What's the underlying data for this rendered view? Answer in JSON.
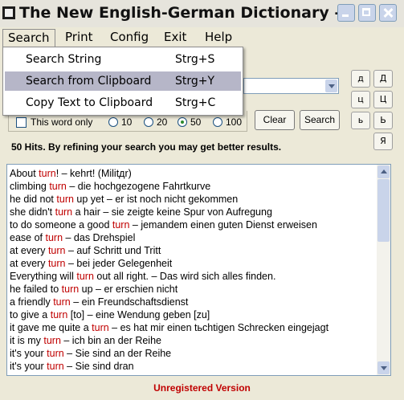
{
  "window": {
    "title": "The New English-German Dictionary - -"
  },
  "menu": [
    "Search",
    "Print",
    "Config",
    "Exit",
    "Help"
  ],
  "search_menu": {
    "items": [
      {
        "label": "Search String",
        "shortcut": "Strg+S"
      },
      {
        "label": "Search from Clipboard",
        "shortcut": "Strg+Y"
      },
      {
        "label": "Copy Text to Clipboard",
        "shortcut": "Strg+C"
      }
    ]
  },
  "search_combo": {
    "value": ""
  },
  "char_buttons": [
    "д",
    "Д",
    "ц",
    "Ц",
    "ь",
    "Ь",
    "Я"
  ],
  "options": {
    "this_word_only": "This word only",
    "limits": [
      "10",
      "20",
      "50",
      "100"
    ],
    "selected_limit": "50",
    "clear": "Clear",
    "search": "Search"
  },
  "hits_message": "50 Hits. By refining your search you may get better results.",
  "results": [
    {
      "pre": "About ",
      "hl": "turn",
      "post": "! – kehrt! (Militдr)"
    },
    {
      "pre": "climbing ",
      "hl": "turn",
      "post": " – die hochgezogene Fahrtkurve"
    },
    {
      "pre": "he did not ",
      "hl": "turn",
      "post": " up yet – er ist noch nicht gekommen"
    },
    {
      "pre": "she didn't ",
      "hl": "turn",
      "post": " a hair – sie zeigte keine Spur von Aufregung"
    },
    {
      "pre": "to do someone a good ",
      "hl": "turn",
      "post": " – jemandem einen guten Dienst erweisen"
    },
    {
      "pre": "ease of ",
      "hl": "turn",
      "post": " – das Drehspiel"
    },
    {
      "pre": "at every ",
      "hl": "turn",
      "post": " – auf Schritt und Tritt"
    },
    {
      "pre": "at every ",
      "hl": "turn",
      "post": " – bei jeder Gelegenheit"
    },
    {
      "pre": "Everything will ",
      "hl": "turn",
      "post": " out all right. – Das wird sich alles finden."
    },
    {
      "pre": "he failed to ",
      "hl": "turn",
      "post": " up – er erschien nicht"
    },
    {
      "pre": "a friendly ",
      "hl": "turn",
      "post": " – ein Freundschaftsdienst"
    },
    {
      "pre": "to give a ",
      "hl": "turn",
      "post": " [to] – eine Wendung geben [zu]"
    },
    {
      "pre": "it gave me quite a ",
      "hl": "turn",
      "post": " – es hat mir einen tьchtigen Schrecken eingejagt"
    },
    {
      "pre": "it is my ",
      "hl": "turn",
      "post": " – ich bin an der Reihe"
    },
    {
      "pre": "it's your ",
      "hl": "turn",
      "post": " – Sie sind an der Reihe"
    },
    {
      "pre": "it's your ",
      "hl": "turn",
      "post": " – Sie sind dran"
    }
  ],
  "status": "Unregistered Version"
}
